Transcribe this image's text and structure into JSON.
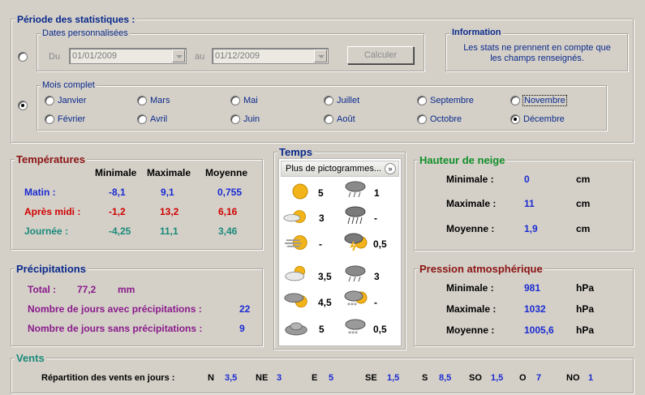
{
  "periode": {
    "title": "Période des statistiques :",
    "dates_perso": {
      "legend": "Dates personnalisées",
      "du_label": "Du",
      "du_value": "01/01/2009",
      "au_label": "au",
      "au_value": "01/12/2009",
      "calc_label": "Calculer"
    },
    "information": {
      "legend": "Information",
      "text_line1": "Les stats ne prennent en compte que",
      "text_line2": "les champs renseignés."
    },
    "mois_complet": {
      "legend": "Mois complet",
      "months": [
        "Janvier",
        "Mars",
        "Mai",
        "Juillet",
        "Septembre",
        "Novembre",
        "Février",
        "Avril",
        "Juin",
        "Août",
        "Octobre",
        "Décembre"
      ],
      "selected": "Décembre"
    }
  },
  "temperatures": {
    "legend": "Températures",
    "headers": [
      "Minimale",
      "Maximale",
      "Moyenne"
    ],
    "rows": [
      {
        "label": "Matin :",
        "min": "-8,1",
        "max": "9,1",
        "moy": "0,755"
      },
      {
        "label": "Après midi :",
        "min": "-1,2",
        "max": "13,2",
        "moy": "6,16"
      },
      {
        "label": "Journée :",
        "min": "-4,25",
        "max": "11,1",
        "moy": "3,46"
      }
    ]
  },
  "temps": {
    "legend": "Temps",
    "dropdown": "Plus de pictogrammes...",
    "items": [
      {
        "icon": "sun-icon",
        "value": "5"
      },
      {
        "icon": "rain-cloud-icon",
        "value": "1"
      },
      {
        "icon": "sun-behind-cloud-icon",
        "value": "3"
      },
      {
        "icon": "heavy-rain-icon",
        "value": "-"
      },
      {
        "icon": "sun-fog-icon",
        "value": "-"
      },
      {
        "icon": "thunderstorm-icon",
        "value": "0,5"
      },
      {
        "icon": "partly-cloudy-icon",
        "value": "3,5"
      },
      {
        "icon": "rain-cloud-2-icon",
        "value": "3"
      },
      {
        "icon": "cloudy-sun-icon",
        "value": "4,5"
      },
      {
        "icon": "snow-sun-icon",
        "value": "-"
      },
      {
        "icon": "overcast-icon",
        "value": "5"
      },
      {
        "icon": "snow-cloud-icon",
        "value": "0,5"
      }
    ]
  },
  "neige": {
    "legend": "Hauteur de neige",
    "rows": [
      {
        "label": "Minimale :",
        "value": "0",
        "unit": "cm"
      },
      {
        "label": "Maximale :",
        "value": "11",
        "unit": "cm"
      },
      {
        "label": "Moyenne :",
        "value": "1,9",
        "unit": "cm"
      }
    ]
  },
  "precipitations": {
    "legend": "Précipitations",
    "total_label": "Total :",
    "total_value": "77,2",
    "total_unit": "mm",
    "avec_label": "Nombre de jours avec précipitations :",
    "avec_value": "22",
    "sans_label": "Nombre de jours sans précipitations :",
    "sans_value": "9"
  },
  "pression": {
    "legend": "Pression atmosphérique",
    "rows": [
      {
        "label": "Minimale :",
        "value": "981",
        "unit": "hPa"
      },
      {
        "label": "Maximale :",
        "value": "1032",
        "unit": "hPa"
      },
      {
        "label": "Moyenne :",
        "value": "1005,6",
        "unit": "hPa"
      }
    ]
  },
  "vents": {
    "legend": "Vents",
    "label": "Répartition des vents en jours :",
    "dirs": [
      {
        "dir": "N",
        "value": "3,5"
      },
      {
        "dir": "NE",
        "value": "3"
      },
      {
        "dir": "E",
        "value": "5"
      },
      {
        "dir": "SE",
        "value": "1,5"
      },
      {
        "dir": "S",
        "value": "8,5"
      },
      {
        "dir": "SO",
        "value": "1,5"
      },
      {
        "dir": "O",
        "value": "7"
      },
      {
        "dir": "NO",
        "value": "1"
      }
    ]
  },
  "colors": {
    "background": "#d4d0c8",
    "navy": "#0b2a8c",
    "blue": "#1a2bd1",
    "red": "#d00000",
    "teal": "#1a8a7a",
    "green": "#128f2a",
    "maroon": "#8b1414",
    "purple": "#8a1a8a"
  }
}
